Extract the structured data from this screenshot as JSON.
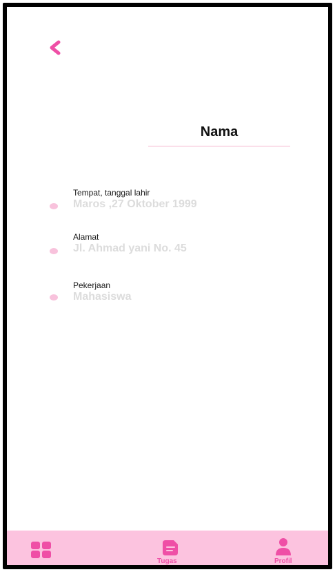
{
  "header": {
    "title": "Nama"
  },
  "profile": {
    "items": [
      {
        "label": "Tempat, tanggal lahir",
        "value": "Maros ,27 Oktober 1999"
      },
      {
        "label": "Alamat",
        "value": "Jl. Ahmad yani  No. 45"
      },
      {
        "label": "Pekerjaan",
        "value": "Mahasiswa"
      }
    ]
  },
  "nav": {
    "items": [
      {
        "icon": "grid-icon",
        "label": ""
      },
      {
        "icon": "document-icon",
        "label": "Tugas"
      },
      {
        "icon": "user-icon",
        "label": "Profil"
      }
    ]
  },
  "colors": {
    "accent": "#ef4fa6",
    "nav_background": "#fcc3df",
    "dot": "#f8c2dc",
    "value_text": "#dcdcdc"
  }
}
